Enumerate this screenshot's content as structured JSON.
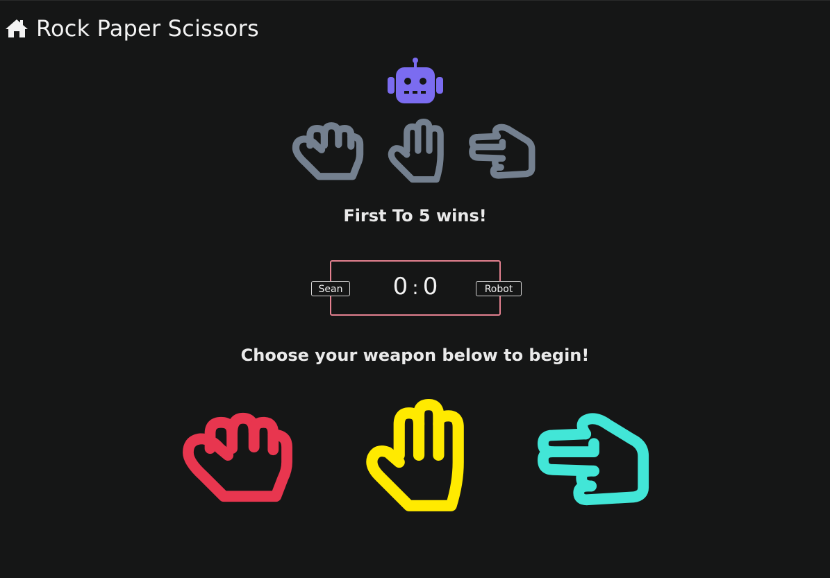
{
  "header": {
    "title": "Rock Paper Scissors",
    "home_icon": "home-icon"
  },
  "opponent": {
    "icon": "robot-icon",
    "hands": [
      "rock-hand-icon",
      "paper-hand-icon",
      "scissors-hand-icon"
    ]
  },
  "goal_text": "First To 5 wins!",
  "scoreboard": {
    "player_name": "Sean",
    "opponent_name": "Robot",
    "player_score": "0",
    "separator": ":",
    "opponent_score": "0"
  },
  "instruction": "Choose your weapon below to begin!",
  "weapons": [
    {
      "name": "rock",
      "icon": "rock-hand-icon",
      "color": "#e8364f"
    },
    {
      "name": "paper",
      "icon": "paper-hand-icon",
      "color": "#ffea00"
    },
    {
      "name": "scissors",
      "icon": "scissors-hand-icon",
      "color": "#42e6d7"
    }
  ],
  "colors": {
    "background": "#151616",
    "robot": "#7b6cf0",
    "cpu_hands": "#74808f",
    "scoreboard_border": "#e48190"
  }
}
